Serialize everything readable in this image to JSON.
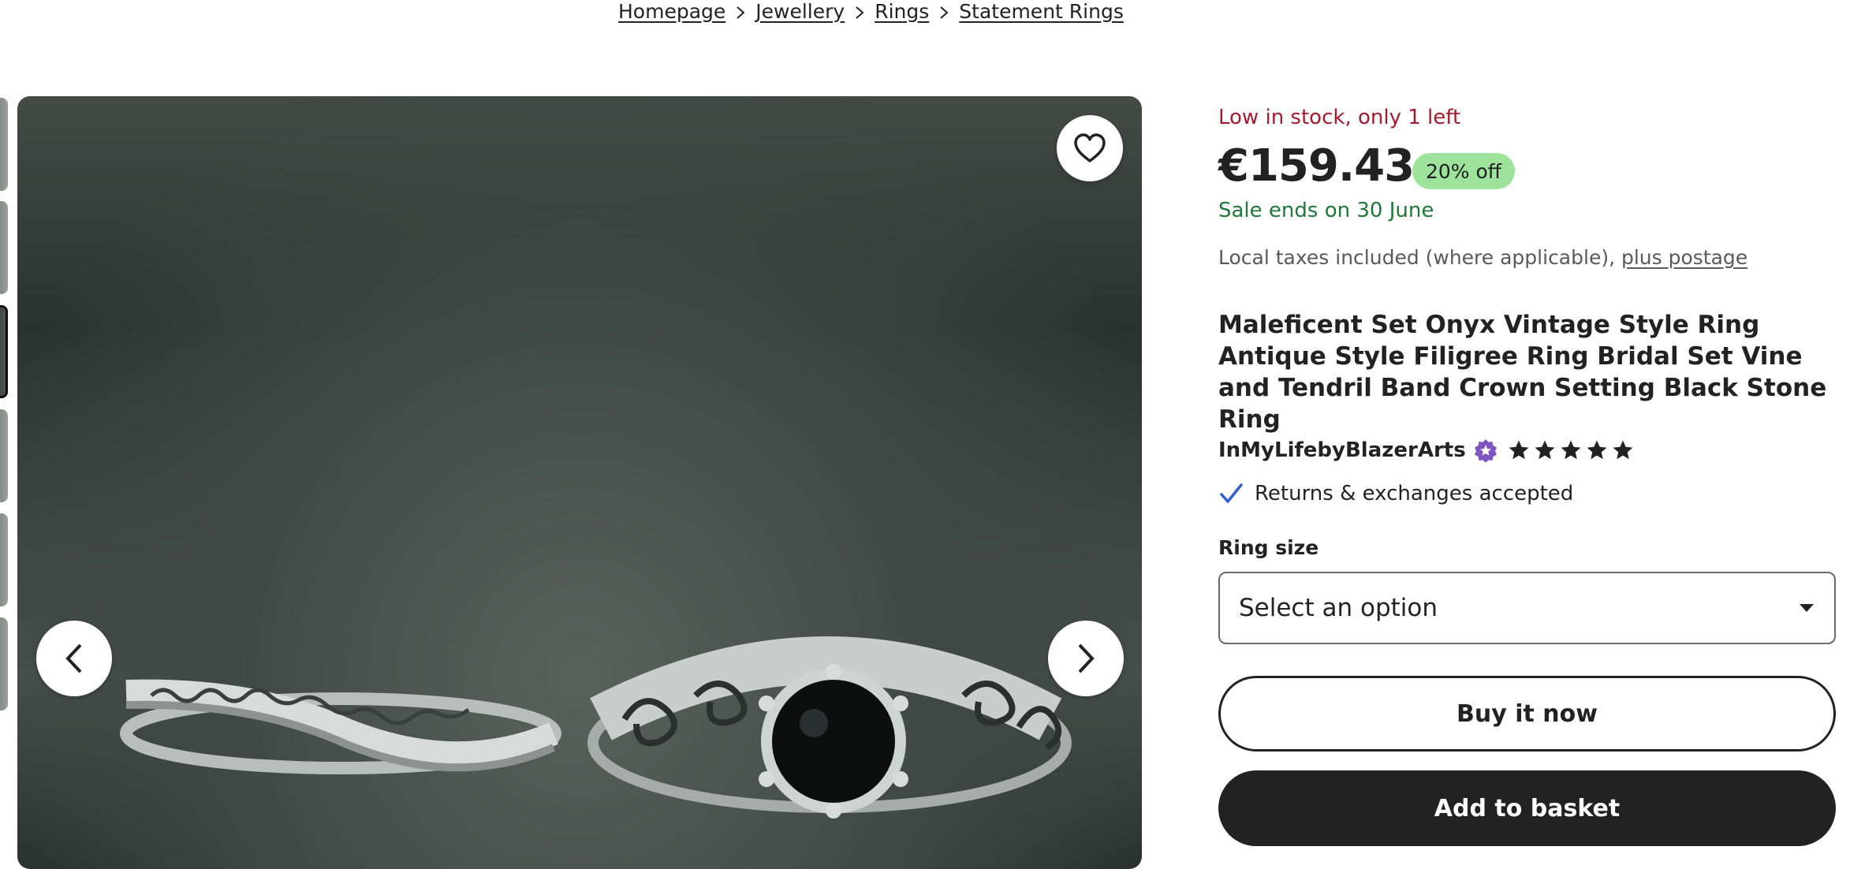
{
  "breadcrumb": {
    "items": [
      "Homepage",
      "Jewellery",
      "Rings",
      "Statement Rings"
    ]
  },
  "listing": {
    "stock_notice": "Low in stock, only 1 left",
    "price": "€159.43",
    "discount_badge": "20% off",
    "sale_ends": "Sale ends on 30 June",
    "taxes_text": "Local taxes included (where applicable),",
    "postage_link": "plus postage",
    "title": "Maleficent Set Onyx Vintage Style Ring Antique Style Filigree Ring Bridal Set Vine and Tendril Band Crown Setting Black Stone Ring"
  },
  "shop": {
    "name": "InMyLifebyBlazerArts",
    "star_seller_icon": "star-seller-badge-icon",
    "rating_stars": 5
  },
  "policies": {
    "returns": "Returns & exchanges accepted"
  },
  "variation": {
    "label": "Ring size",
    "selected": "Select an option"
  },
  "actions": {
    "buy_now": "Buy it now",
    "add_to_basket": "Add to basket"
  },
  "colors": {
    "stock_notice": "#a61a2e",
    "sale_green": "#1f7a3a",
    "discount_badge_bg": "#9ee39b",
    "star_seller_purple": "#7f55c2",
    "check_blue": "#2f5fcf",
    "primary_dark": "#222222"
  },
  "icons": {
    "favorite": "heart-icon",
    "previous": "chevron-left-icon",
    "next": "chevron-right-icon",
    "crumb_separator": "chevron-right-icon",
    "returns": "checkmark-icon",
    "select_caret": "caret-down-icon"
  }
}
